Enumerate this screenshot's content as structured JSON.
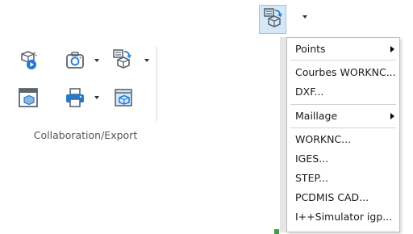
{
  "toolbar_group": {
    "label": "Collaboration/Export",
    "buttons": [
      {
        "name": "share-button",
        "icon": "share-cloud-play-icon"
      },
      {
        "name": "camera-button",
        "icon": "camera-icon",
        "has_dropdown": true
      },
      {
        "name": "export-button",
        "icon": "export-icon",
        "has_dropdown": true
      },
      {
        "name": "window-export-button",
        "icon": "window-icon"
      },
      {
        "name": "print-button",
        "icon": "printer-icon",
        "has_dropdown": true
      },
      {
        "name": "package-button",
        "icon": "package-icon"
      }
    ]
  },
  "export_menu": {
    "items": [
      {
        "label": "Points",
        "submenu": true
      },
      {
        "label": "Courbes WORKNC...",
        "submenu": false
      },
      {
        "label": "DXF...",
        "submenu": false
      },
      {
        "label": "Maillage",
        "submenu": true
      },
      {
        "label": "WORKNC...",
        "submenu": false
      },
      {
        "label": "IGES...",
        "submenu": false
      },
      {
        "label": "STEP...",
        "submenu": false
      },
      {
        "label": "PCDMIS CAD...",
        "submenu": false
      },
      {
        "label": "I++Simulator igp...",
        "submenu": false
      }
    ]
  },
  "colors": {
    "accent": "#1f7bd4",
    "icon_gray": "#5b6670",
    "selected_bg": "#d6e8f7"
  }
}
